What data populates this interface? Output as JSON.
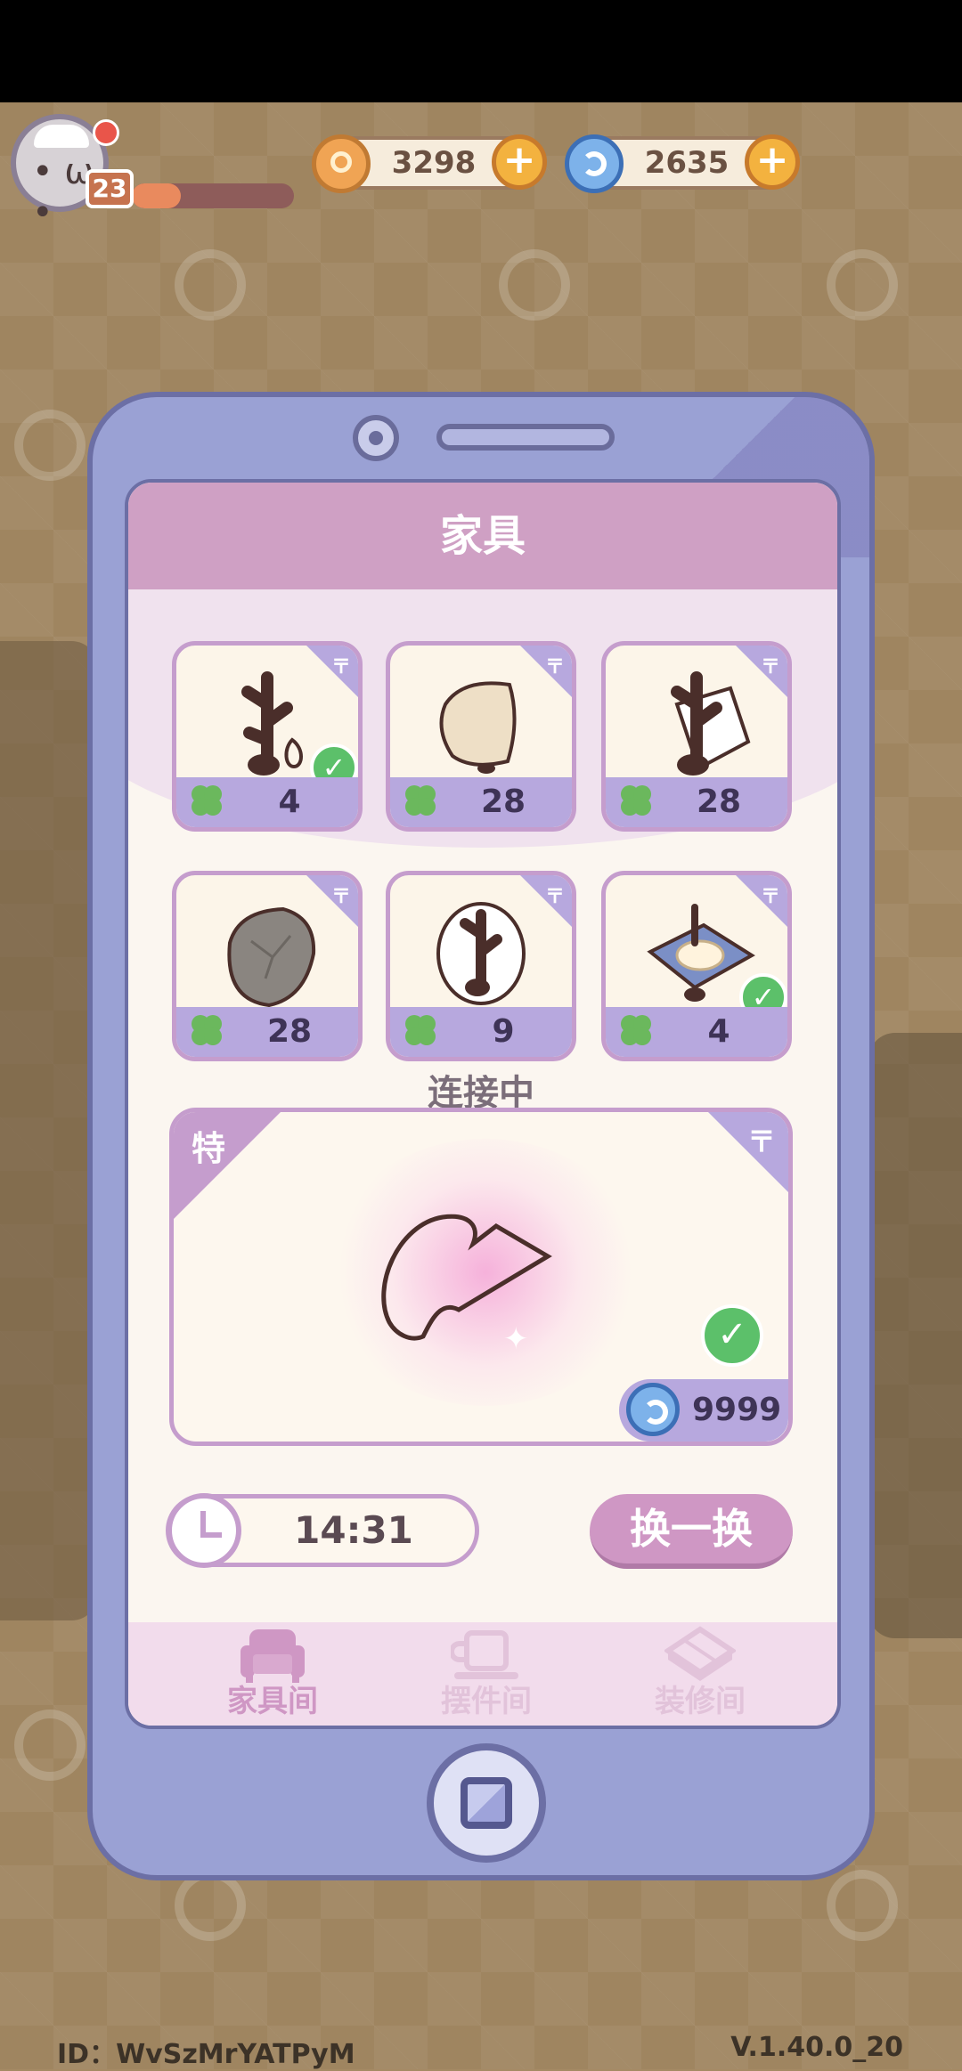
{
  "hud": {
    "level": "23",
    "xp_fraction": 0.3,
    "coins": "3298",
    "gems": "2635"
  },
  "panel": {
    "title": "家具",
    "items": [
      {
        "price": "4",
        "owned": true
      },
      {
        "price": "28",
        "owned": false
      },
      {
        "price": "28",
        "owned": false
      },
      {
        "price": "28",
        "owned": false
      },
      {
        "price": "9",
        "owned": false
      },
      {
        "price": "4",
        "owned": true
      }
    ],
    "connecting_text": "连接中",
    "special": {
      "tag": "特",
      "price": "9999",
      "owned": true
    },
    "timer": "14:31",
    "swap_button": "换一换",
    "tabs": [
      {
        "label": "家具间",
        "icon": "sofa-icon",
        "active": true
      },
      {
        "label": "摆件间",
        "icon": "cup-icon",
        "active": false
      },
      {
        "label": "装修间",
        "icon": "floor-tile-icon",
        "active": false
      }
    ]
  },
  "footer": {
    "id": "ID：WvSzMrYATPyM",
    "version": "V.1.40.0_20"
  },
  "colors": {
    "accent": "#cfa0c4",
    "tile_border": "#c59dcd",
    "price_band": "#b7a8de",
    "phone_body": "#9aa1d4",
    "check_green": "#5cc06a"
  }
}
